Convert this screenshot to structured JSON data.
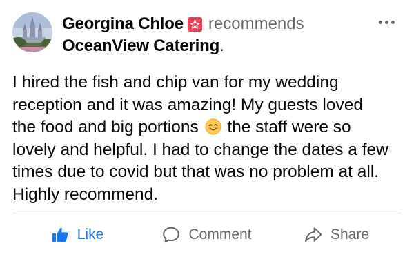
{
  "post": {
    "author": "Georgina Chloe",
    "recommendation_icon": "star-badge-icon",
    "verb": "recommends",
    "business": "OceanView Catering",
    "period": ".",
    "more_icon": "more-dots-icon",
    "body_lines": [
      "I hired the fish and chip van for my wedding",
      "reception and it was amazing! My guests loved",
      "the food and big portions",
      "the staff were so",
      "lovely and helpful. I had to change the dates a few",
      "times due to covid but that was no problem at all.",
      "Highly recommend."
    ],
    "emoji": "smiling-face-emoji"
  },
  "actions": {
    "like": {
      "label": "Like",
      "icon": "thumbs-up-icon"
    },
    "comment": {
      "label": "Comment",
      "icon": "comment-icon"
    },
    "share": {
      "label": "Share",
      "icon": "share-icon"
    }
  },
  "colors": {
    "like_blue": "#1877f2",
    "badge_red": "#f33e58",
    "secondary_text": "#65676b",
    "primary_text": "#050505",
    "divider": "#ced0d4"
  }
}
